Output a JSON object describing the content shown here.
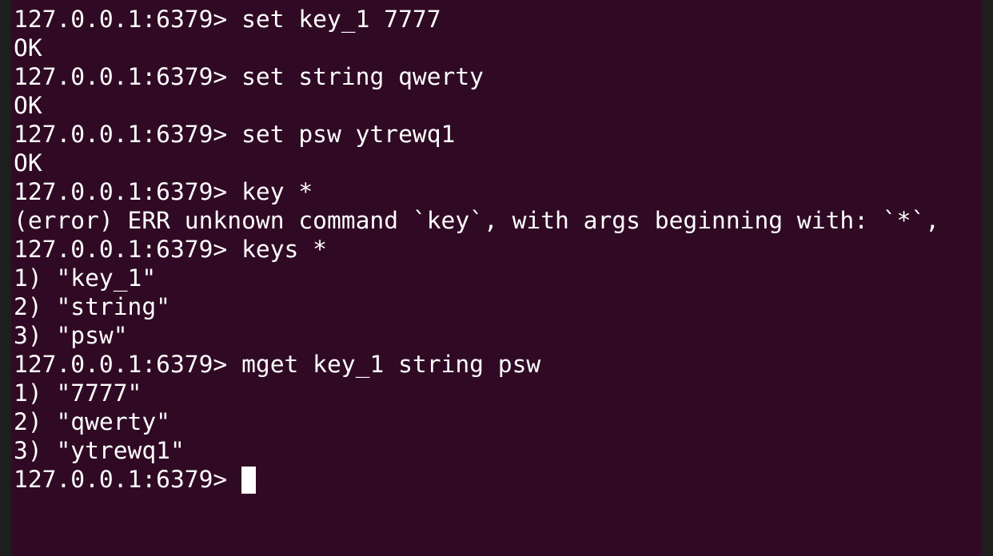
{
  "terminal": {
    "colors": {
      "background": "#300a24",
      "foreground": "#ffffff"
    },
    "lines": [
      {
        "prompt": "127.0.0.1:6379>",
        "command": "set key_1 7777"
      },
      {
        "output": "OK"
      },
      {
        "prompt": "127.0.0.1:6379>",
        "command": "set string qwerty"
      },
      {
        "output": "OK"
      },
      {
        "prompt": "127.0.0.1:6379>",
        "command": "set psw ytrewq1"
      },
      {
        "output": "OK"
      },
      {
        "prompt": "127.0.0.1:6379>",
        "command": "key *"
      },
      {
        "output": "(error) ERR unknown command `key`, with args beginning with: `*`,"
      },
      {
        "prompt": "127.0.0.1:6379>",
        "command": "keys *"
      },
      {
        "output": "1) \"key_1\""
      },
      {
        "output": "2) \"string\""
      },
      {
        "output": "3) \"psw\""
      },
      {
        "prompt": "127.0.0.1:6379>",
        "command": "mget key_1 string psw"
      },
      {
        "output": "1) \"7777\""
      },
      {
        "output": "2) \"qwerty\""
      },
      {
        "output": "3) \"ytrewq1\""
      }
    ],
    "current_prompt": "127.0.0.1:6379>"
  }
}
